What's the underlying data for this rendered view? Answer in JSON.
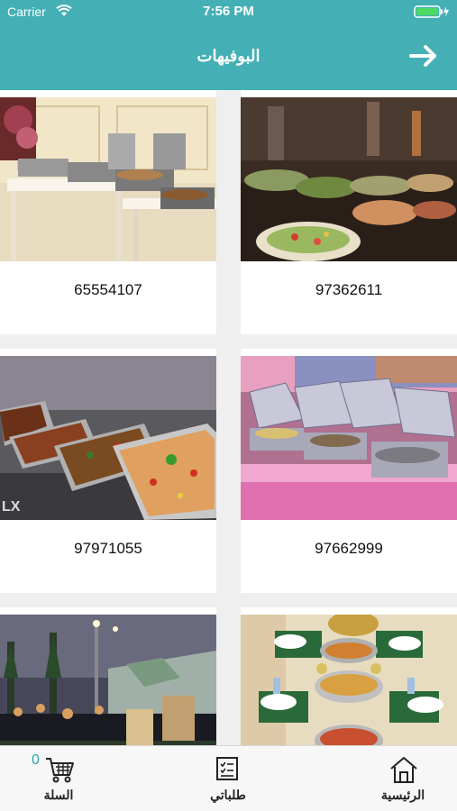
{
  "status": {
    "carrier": "Carrier",
    "time": "7:56 PM"
  },
  "header": {
    "title": "البوفيهات"
  },
  "buffets": [
    {
      "phone": "97362611"
    },
    {
      "phone": "65554107"
    },
    {
      "phone": "97662999"
    },
    {
      "phone": "97971055"
    },
    {
      "phone": ""
    },
    {
      "phone": ""
    }
  ],
  "tabbar": {
    "home_label": "الرئيسية",
    "orders_label": "طلباتي",
    "cart_label": "السلة",
    "cart_count": "0"
  },
  "colors": {
    "accent": "#44b0b5"
  },
  "icons": [
    "wifi-icon",
    "battery-icon",
    "back-arrow-icon",
    "home-icon",
    "orders-icon",
    "cart-icon"
  ]
}
